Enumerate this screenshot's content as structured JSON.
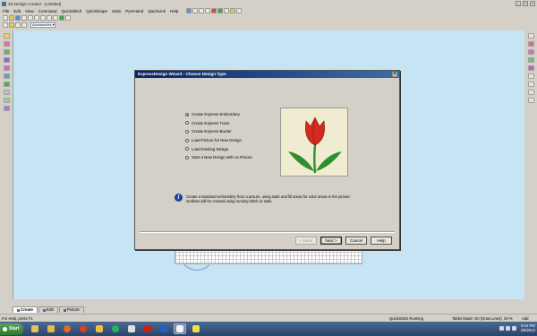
{
  "app": {
    "title": "4D Design Creator - [Untitled]"
  },
  "menu": [
    "File",
    "Edit",
    "View",
    "Command",
    "QuickStitch",
    "QuickDrape",
    "Satin",
    "PyreHand",
    "QuickLink",
    "Help"
  ],
  "toolbar": {
    "accessories_label": "Accessories"
  },
  "dialog": {
    "title": "ExpressDesign Wizard - Choose Design Type",
    "options": [
      {
        "label": "Create Express Embroidery",
        "checked": true
      },
      {
        "label": "Create Express Trace",
        "checked": false
      },
      {
        "label": "Create Express Border",
        "checked": false
      },
      {
        "label": "Load Picture for New Design",
        "checked": false
      },
      {
        "label": "Load Existing Design",
        "checked": false
      },
      {
        "label": "Start a New Design with no Picture",
        "checked": false
      }
    ],
    "info_text": "Create a standard embroidery from a picture, using satin and fill areas for color areas in the picture. Outlines will be created using running stitch or satin.",
    "buttons": {
      "back": "< Back",
      "next": "Next >",
      "cancel": "Cancel",
      "help": "Help"
    }
  },
  "tabs": {
    "create": "Create",
    "edit": "Edit",
    "picture": "Picture"
  },
  "status": {
    "help": "For Help, press F1",
    "quickstitch": "QuickStitch Running",
    "tablet": "Tablet Mode: On (Draw Lines)",
    "zoom": "29 %",
    "mode": "Add"
  },
  "taskbar": {
    "start_label": "Start",
    "time": "8:04 PM",
    "date": "2/8/2014"
  },
  "colors": {
    "title_bar": "#0a246a",
    "canvas": "#c7e4f4",
    "tulip_red": "#d22b1f",
    "tulip_green": "#2e8f2e"
  }
}
